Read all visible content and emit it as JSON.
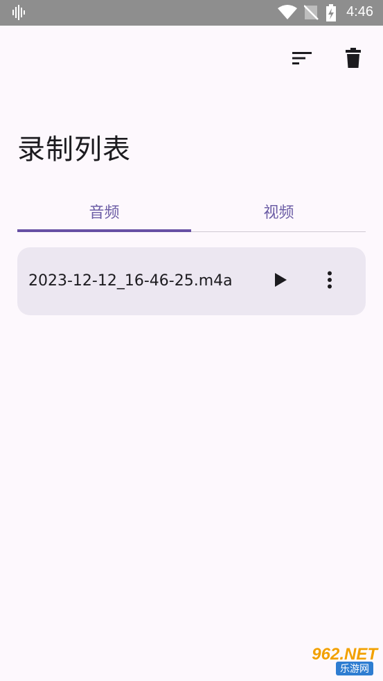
{
  "status_bar": {
    "time": "4:46",
    "icons": [
      "sound-wave-icon",
      "wifi-icon",
      "no-signal-icon",
      "battery-charging-icon"
    ]
  },
  "toolbar": {
    "icons": [
      "sort-icon",
      "delete-icon"
    ]
  },
  "page": {
    "title": "录制列表"
  },
  "tabs": [
    {
      "label": "音频",
      "selected": true
    },
    {
      "label": "视频",
      "selected": false
    }
  ],
  "recordings": [
    {
      "file_name": "2023-12-12_16-46-25.m4a",
      "icons": [
        "play-icon",
        "more-vert-icon"
      ]
    }
  ],
  "watermark": {
    "text_main": "962.NET",
    "text_sub": "乐游网"
  },
  "colors": {
    "accent": "#6750A4",
    "tab_text": "#6B5CA5",
    "card_bg": "#ECE7F1",
    "page_bg": "#FDF8FD",
    "status_bar_bg": "#8E8E8E"
  }
}
